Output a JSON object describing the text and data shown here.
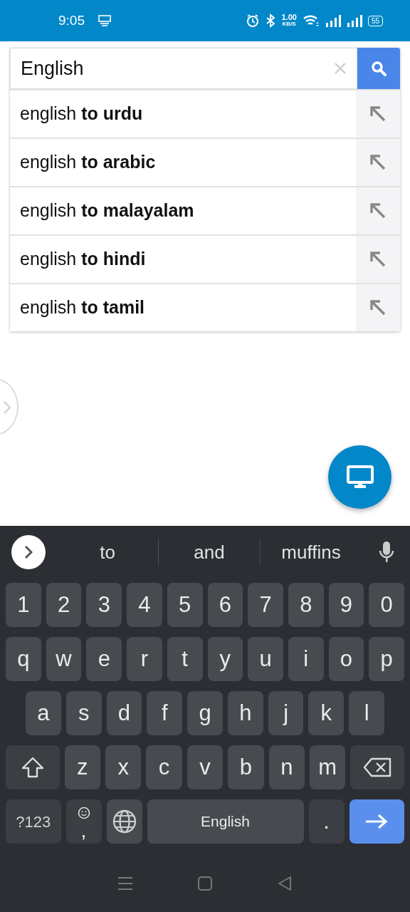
{
  "status_bar": {
    "time": "9:05",
    "speed_value": "1.00",
    "speed_unit": "KB/S",
    "battery": "55"
  },
  "search": {
    "value": "English"
  },
  "suggestions": [
    {
      "text": "english **to urdu**"
    },
    {
      "text": "english **to arabic**"
    },
    {
      "text": "english **to malayalam**"
    },
    {
      "text": "english **to hindi**"
    },
    {
      "text": "english **to tamil**"
    }
  ],
  "keyboard": {
    "word_suggestions": [
      "to",
      "and",
      "muffins"
    ],
    "key_rows": [
      {
        "keys": [
          {
            "kind": "char",
            "label": "1"
          },
          {
            "kind": "char",
            "label": "2"
          },
          {
            "kind": "char",
            "label": "3"
          },
          {
            "kind": "char",
            "label": "4"
          },
          {
            "kind": "char",
            "label": "5"
          },
          {
            "kind": "char",
            "label": "6"
          },
          {
            "kind": "char",
            "label": "7"
          },
          {
            "kind": "char",
            "label": "8"
          },
          {
            "kind": "char",
            "label": "9"
          },
          {
            "kind": "char",
            "label": "0"
          }
        ]
      },
      {
        "keys": [
          {
            "kind": "char",
            "label": "q"
          },
          {
            "kind": "char",
            "label": "w"
          },
          {
            "kind": "char",
            "label": "e"
          },
          {
            "kind": "char",
            "label": "r"
          },
          {
            "kind": "char",
            "label": "t"
          },
          {
            "kind": "char",
            "label": "y"
          },
          {
            "kind": "char",
            "label": "u"
          },
          {
            "kind": "char",
            "label": "i"
          },
          {
            "kind": "char",
            "label": "o"
          },
          {
            "kind": "char",
            "label": "p"
          }
        ]
      },
      {
        "keys": [
          {
            "kind": "char",
            "label": "a"
          },
          {
            "kind": "char",
            "label": "s"
          },
          {
            "kind": "char",
            "label": "d"
          },
          {
            "kind": "char",
            "label": "f"
          },
          {
            "kind": "char",
            "label": "g"
          },
          {
            "kind": "char",
            "label": "h"
          },
          {
            "kind": "char",
            "label": "j"
          },
          {
            "kind": "char",
            "label": "k"
          },
          {
            "kind": "char",
            "label": "l"
          }
        ]
      },
      {
        "keys": [
          {
            "kind": "shift"
          },
          {
            "kind": "char",
            "label": "z"
          },
          {
            "kind": "char",
            "label": "x"
          },
          {
            "kind": "char",
            "label": "c"
          },
          {
            "kind": "char",
            "label": "v"
          },
          {
            "kind": "char",
            "label": "b"
          },
          {
            "kind": "char",
            "label": "n"
          },
          {
            "kind": "char",
            "label": "m"
          },
          {
            "kind": "backspace"
          }
        ]
      },
      {
        "keys": [
          {
            "kind": "symbols",
            "label": "?123"
          },
          {
            "kind": "emoji",
            "label": ","
          },
          {
            "kind": "globe"
          },
          {
            "kind": "space",
            "label": "English"
          },
          {
            "kind": "period",
            "label": "."
          },
          {
            "kind": "enter"
          }
        ]
      }
    ]
  }
}
